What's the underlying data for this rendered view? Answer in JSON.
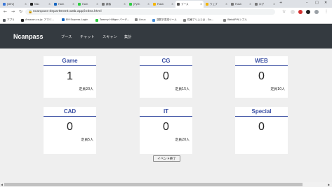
{
  "browser": {
    "tabs": [
      {
        "label": "[DEV]",
        "color": "#3c78d8"
      },
      {
        "label": "Mac",
        "color": "#222222"
      },
      {
        "label": "Hom",
        "color": "#1565c0"
      },
      {
        "label": "Hom",
        "color": "#2ecc40"
      },
      {
        "label": "顧客",
        "color": "#777777"
      },
      {
        "label": "[Pyth",
        "color": "#2ecc40"
      },
      {
        "label": "Flask",
        "color": "#f4b400"
      },
      {
        "label": "ブース",
        "color": "#555555"
      },
      {
        "label": "ウェブ",
        "color": "#f4b400"
      },
      {
        "label": "Flask",
        "color": "#777777"
      },
      {
        "label": "ログ",
        "color": "#777777"
      }
    ],
    "url": "ncanpass-department.web.app/index.html",
    "bookmarks": [
      {
        "label": "アプリ",
        "color": "#5f6368"
      },
      {
        "label": "Amazon.co.jp: アマゾ...",
        "color": "#222222"
      },
      {
        "label": "EM Express Login",
        "color": "#1565c0"
      },
      {
        "label": "Tommy Hilfiger バーゲ...",
        "color": "#2ecc40"
      },
      {
        "label": "Linux",
        "color": "#888888"
      },
      {
        "label": "漢数字変換ツール",
        "color": "#4a90d9"
      },
      {
        "label": "性格了リ上とは - Go...",
        "color": "#888888"
      },
      {
        "label": "WebAPIサンプル",
        "color": "#888888"
      }
    ]
  },
  "navbar": {
    "brand": "Ncanpass",
    "links": [
      "ブース",
      "チャット",
      "スキャン",
      "集計"
    ]
  },
  "cards": [
    {
      "title": "Game",
      "count": "1",
      "capacity": "定員20人"
    },
    {
      "title": "CG",
      "count": "0",
      "capacity": "定員15人"
    },
    {
      "title": "WEB",
      "count": "0",
      "capacity": "定員10人"
    },
    {
      "title": "CAD",
      "count": "0",
      "capacity": "定員5人"
    },
    {
      "title": "IT",
      "count": "0",
      "capacity": "定員20人"
    },
    {
      "title": "Special",
      "count": "0",
      "capacity": ""
    }
  ],
  "end_button": "イベント終了",
  "colors": {
    "navbar": "#343a40",
    "accent": "#3a4fa3",
    "background": "#efefef"
  }
}
